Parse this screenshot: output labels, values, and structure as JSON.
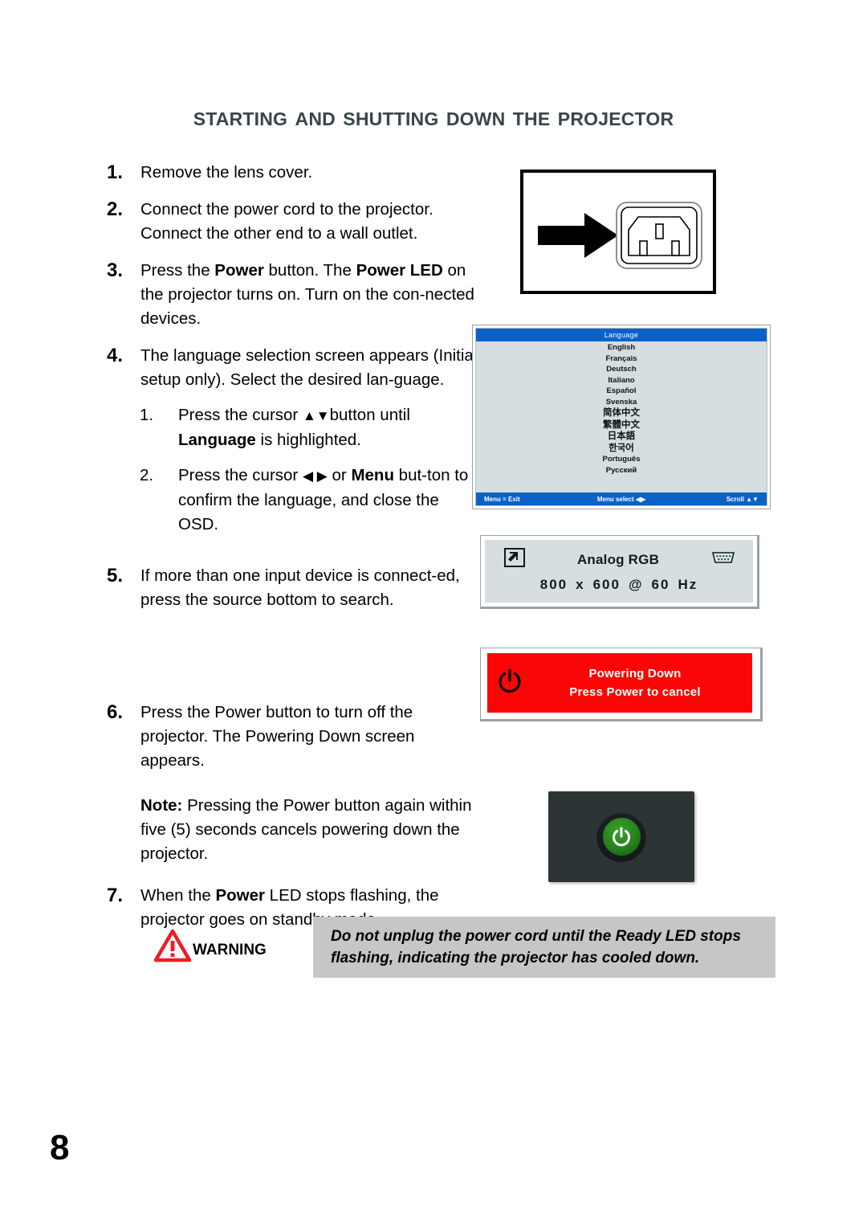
{
  "page": {
    "title": "Starting and Shutting Down the Projector",
    "number": "8",
    "title_color": "#39454a"
  },
  "steps": [
    {
      "num": "1.",
      "text_parts": [
        {
          "t": "Remove the lens cover.",
          "b": false
        }
      ]
    },
    {
      "num": "2.",
      "text_parts": [
        {
          "t": "Connect the power cord to the projector. Connect the other end to a wall outlet.",
          "b": false
        }
      ]
    },
    {
      "num": "3.",
      "text_parts": [
        {
          "t": "Press the ",
          "b": false
        },
        {
          "t": "Power",
          "b": true
        },
        {
          "t": " button. The ",
          "b": false
        },
        {
          "t": "Power LED",
          "b": true
        },
        {
          "t": " on the projector turns on. Turn on the con-nected devices.",
          "b": false
        }
      ]
    },
    {
      "num": "4.",
      "text_parts": [
        {
          "t": "The language selection screen appears (Initial setup only). Select the desired lan-guage.",
          "b": false
        }
      ]
    },
    {
      "num": "5.",
      "text_parts": [
        {
          "t": "If more than one input device is connect-ed, press the source bottom to search.",
          "b": false
        }
      ]
    },
    {
      "num": "6.",
      "text_parts": [
        {
          "t": "Press the Power button to turn off the projector.  The Powering Down screen appears.",
          "b": false
        }
      ]
    },
    {
      "num": "7.",
      "text_parts": [
        {
          "t": "When the ",
          "b": false
        },
        {
          "t": "Power",
          "b": true
        },
        {
          "t": " LED stops flashing, the projector goes on standby mode.",
          "b": false
        }
      ]
    }
  ],
  "substeps": [
    {
      "num": "1.",
      "parts": [
        {
          "t": "Press the cursor ",
          "b": false
        },
        {
          "t": "▲▼",
          "b": false,
          "glyph": true
        },
        {
          "t": "button until ",
          "b": false
        },
        {
          "t": "Language",
          "b": true
        },
        {
          "t": " is highlighted.",
          "b": false
        }
      ]
    },
    {
      "num": "2.",
      "parts": [
        {
          "t": "Press the cursor ",
          "b": false
        },
        {
          "t": "◀ ▶",
          "b": false,
          "glyph": true
        },
        {
          "t": " or ",
          "b": false
        },
        {
          "t": "Menu",
          "b": true
        },
        {
          "t": " but-ton to confirm the language, and close the OSD.",
          "b": false
        }
      ]
    }
  ],
  "note": {
    "label": "Note:",
    "text": " Pressing the Power button again within five (5) seconds cancels powering down the projector."
  },
  "figures": {
    "inlet": {
      "name": "power-inlet-diagram",
      "arrow_icon": "right-arrow-icon",
      "socket_icon": "iec-power-inlet-icon"
    },
    "osd": {
      "title": "Language",
      "items": [
        "English",
        "Français",
        "Deutsch",
        "Italiano",
        "Español",
        "Svenska",
        "简体中文",
        "繁體中文",
        "日本語",
        "한국어",
        "Português",
        "Русский"
      ],
      "cjk_flags": [
        false,
        false,
        false,
        false,
        false,
        false,
        true,
        true,
        true,
        true,
        false,
        false
      ],
      "footer_left": "Menu = Exit",
      "footer_mid": "Menu select ◀▶",
      "footer_right": "Scroll ▲▼",
      "bar_color": "#0a62c8",
      "panel_color": "#d6dee1"
    },
    "source": {
      "title": "Analog RGB",
      "resolution_width": "800",
      "separator": "x",
      "resolution_height": "600",
      "at": "@",
      "refresh": "60",
      "unit": "Hz",
      "source_icon": "source-input-icon",
      "connector_icon": "vga-connector-icon",
      "panel_color": "#d6dee1"
    },
    "powerdown": {
      "line1": "Powering Down",
      "line2": "Press Power to cancel",
      "icon": "power-icon",
      "bg_color": "#fb0606"
    },
    "power_button": {
      "name": "projector-power-button-photo",
      "led_color": "#26821c",
      "icon": "power-icon"
    }
  },
  "warning": {
    "label": "Warning",
    "icon": "warning-triangle-icon",
    "line1": "Do not unplug the power cord until the Ready LED stops",
    "line2": "flashing, indicating the projector has cooled down.",
    "bg_color": "#c6c6c6",
    "icon_color": "#ee1c25"
  }
}
